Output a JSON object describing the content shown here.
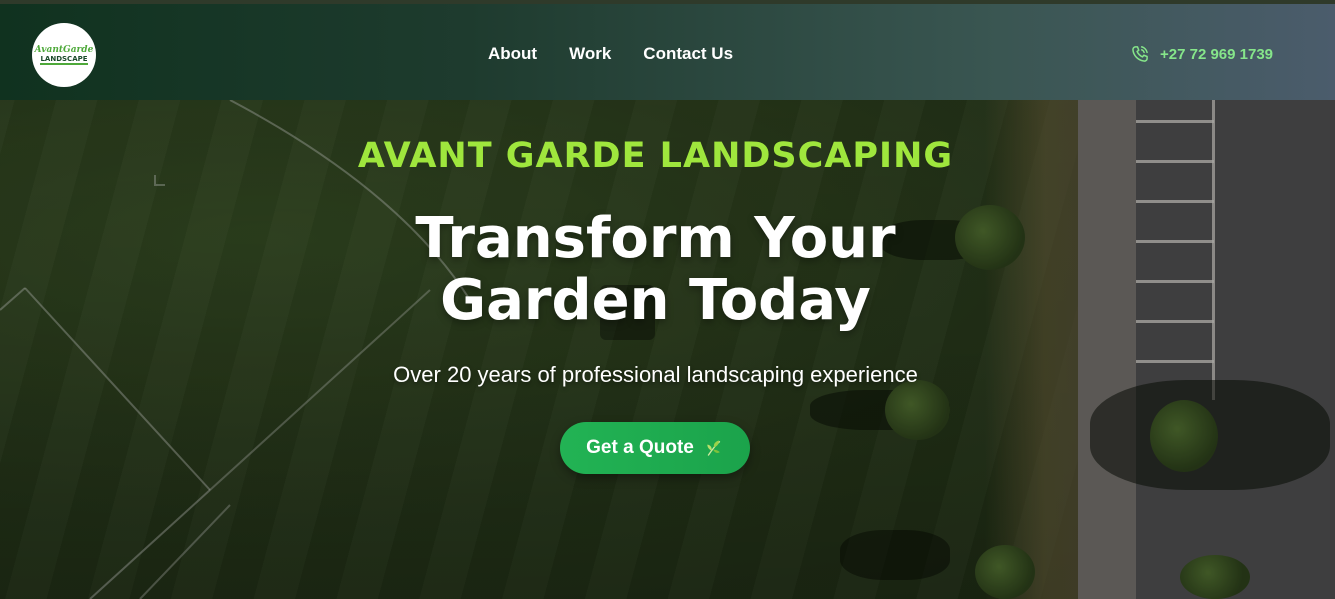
{
  "nav": {
    "logo_text_top": "AvantGarde",
    "logo_text_bottom": "LANDSCAPE",
    "links": [
      {
        "label": "About"
      },
      {
        "label": "Work"
      },
      {
        "label": "Contact Us"
      }
    ],
    "phone": "+27 72 969 1739",
    "phone_icon": "phone-icon"
  },
  "hero": {
    "brand": "AVANT GARDE LANDSCAPING",
    "headline_line1": "Transform Your",
    "headline_line2": "Garden Today",
    "subtitle": "Over 20 years of professional landscaping experience",
    "cta_label": "Get a Quote",
    "cta_icon": "leaf-icon",
    "background": "aerial-lawn-photo"
  },
  "colors": {
    "accent": "#9fe63d",
    "button": "#22b354",
    "phone": "#86e68a",
    "nav_start": "#10321f",
    "nav_end": "#4b5c6c"
  }
}
